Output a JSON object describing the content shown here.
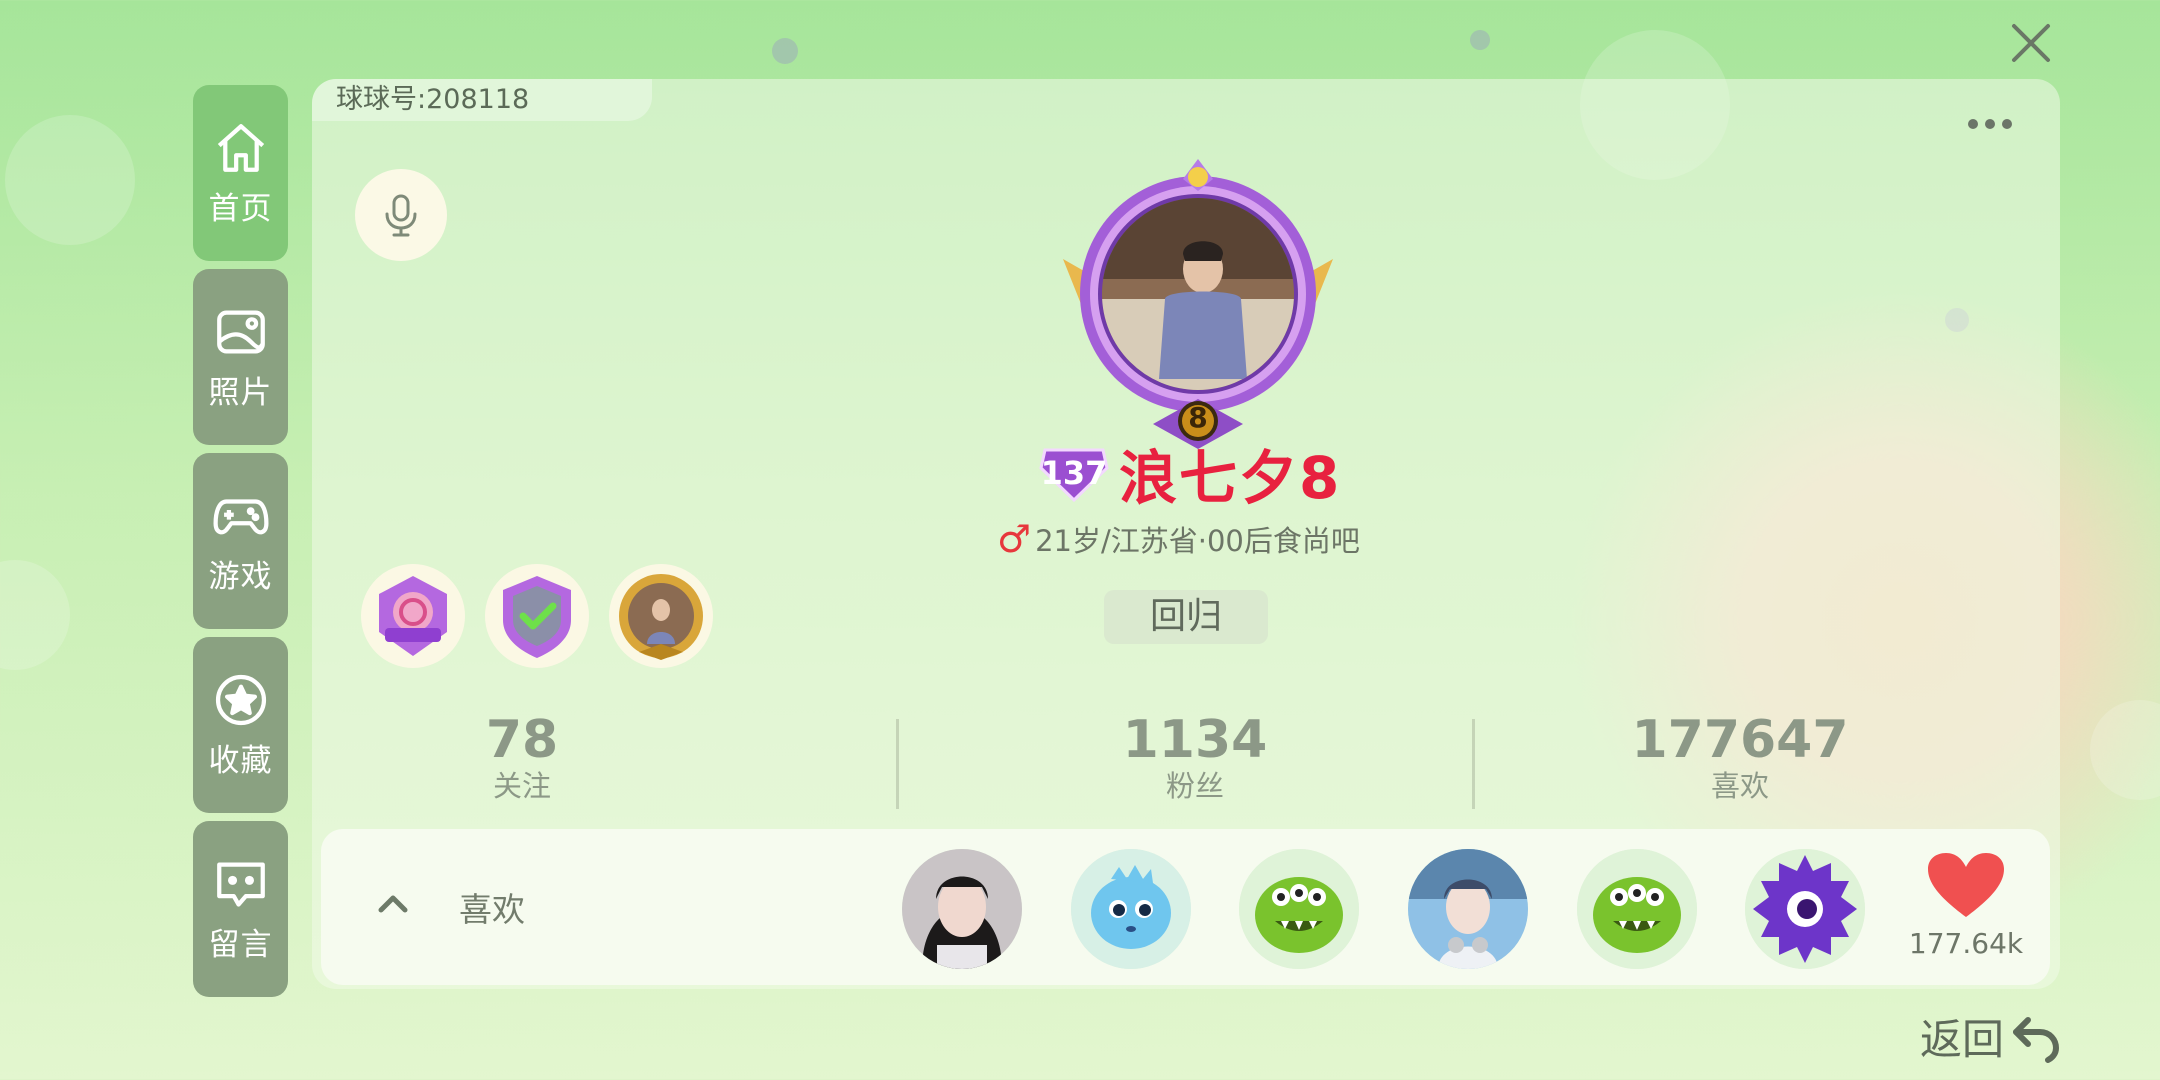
{
  "profile": {
    "id_label": "球球号:",
    "id_value": "208118",
    "username": "浪七夕8",
    "level": "137",
    "frame_level": "8",
    "gender_symbol": "♂",
    "info": "21岁/江苏省·00后食尚吧",
    "status_tag": "回归"
  },
  "sidebar": {
    "items": [
      {
        "label": "首页",
        "icon": "home-icon"
      },
      {
        "label": "照片",
        "icon": "image-icon"
      },
      {
        "label": "游戏",
        "icon": "gamepad-icon"
      },
      {
        "label": "收藏",
        "icon": "star-icon"
      },
      {
        "label": "留言",
        "icon": "message-icon"
      }
    ]
  },
  "stats": {
    "following": {
      "value": "78",
      "label": "关注"
    },
    "fans": {
      "value": "1134",
      "label": "粉丝"
    },
    "likes": {
      "value": "177647",
      "label": "喜欢"
    }
  },
  "likes_bar": {
    "label": "喜欢",
    "total": "177.64k"
  },
  "nav": {
    "back_label": "返回"
  },
  "colors": {
    "active_nav": "#82c878",
    "nav": "#8aa181",
    "username": "#e8213f"
  }
}
